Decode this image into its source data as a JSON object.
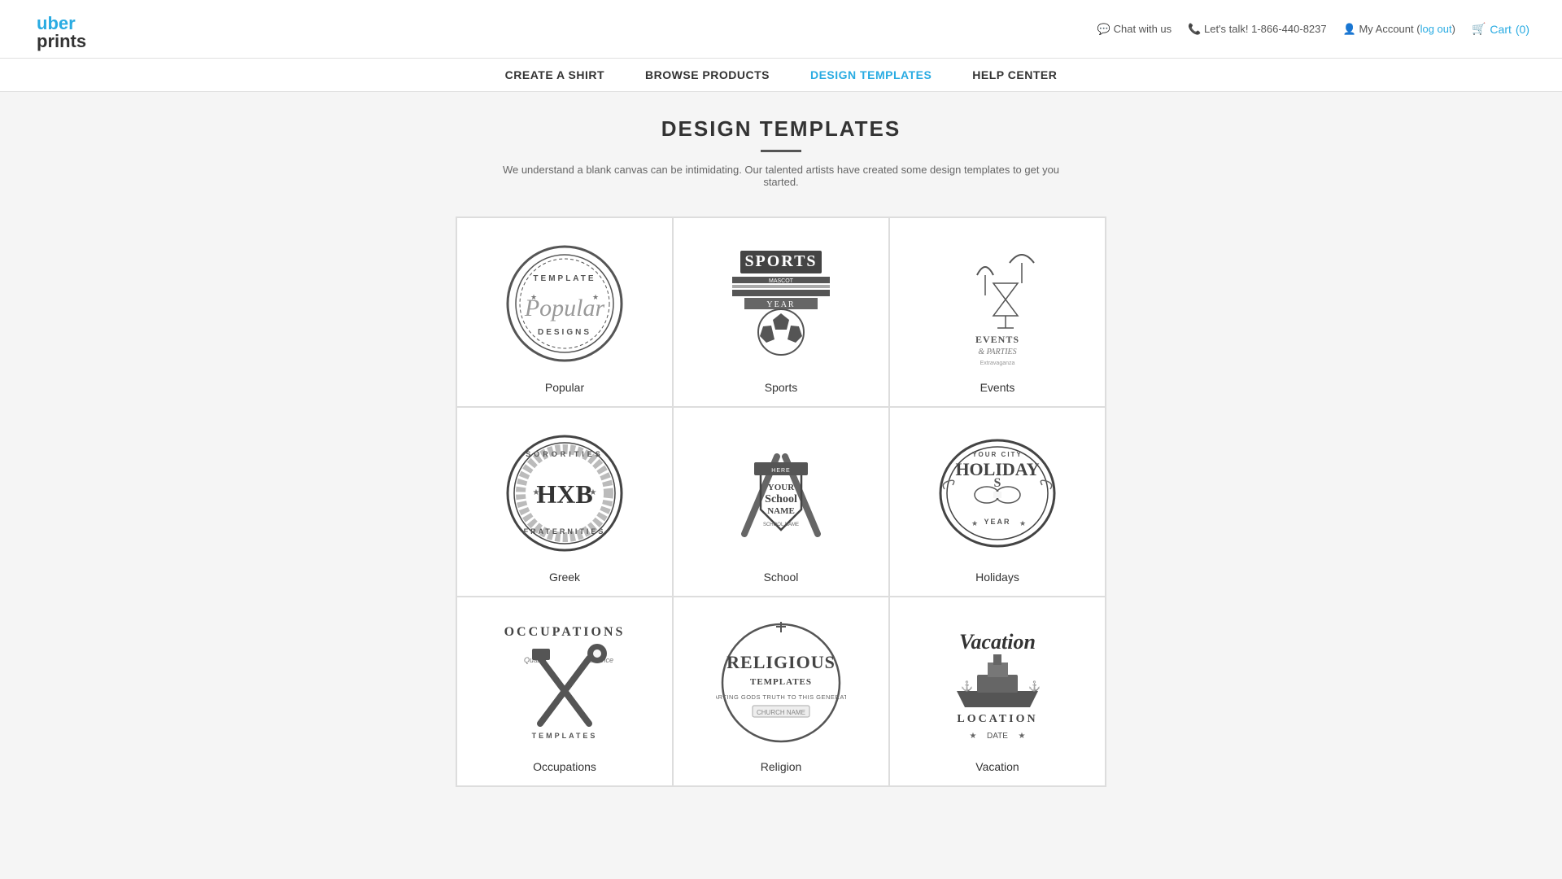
{
  "header": {
    "logo_text": "uber",
    "logo_text2": "prints",
    "chat_label": "Chat with us",
    "phone_label": "Let's talk! 1-866-440-8237",
    "account_label": "My Account",
    "logout_label": "log out",
    "cart_label": "Cart",
    "cart_count": "(0)"
  },
  "nav": {
    "items": [
      {
        "id": "create",
        "label": "CREATE A SHIRT"
      },
      {
        "id": "browse",
        "label": "BROWSE PRODUCTS"
      },
      {
        "id": "design",
        "label": "DESIGN TEMPLATES",
        "active": true
      },
      {
        "id": "help",
        "label": "HELP CENTER"
      }
    ]
  },
  "page": {
    "title": "DESIGN TEMPLATES",
    "subtitle": "We understand a blank canvas can be intimidating. Our talented artists have created some design templates to get you started."
  },
  "templates": [
    {
      "id": "popular",
      "label": "Popular"
    },
    {
      "id": "sports",
      "label": "Sports"
    },
    {
      "id": "events",
      "label": "Events"
    },
    {
      "id": "greek",
      "label": "Greek"
    },
    {
      "id": "school",
      "label": "School"
    },
    {
      "id": "holidays",
      "label": "Holidays"
    },
    {
      "id": "occupations",
      "label": "Occupations"
    },
    {
      "id": "religion",
      "label": "Religion"
    },
    {
      "id": "vacation",
      "label": "Vacation"
    }
  ]
}
